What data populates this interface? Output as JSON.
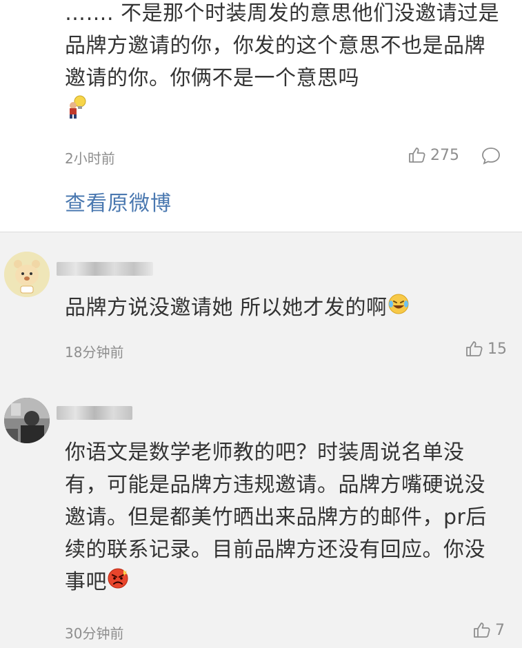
{
  "top_comment": {
    "text": "……. 不是那个时装周发的意思他们没邀请过是品牌方邀请的你，你发的这个意思不也是品牌邀请的你。你俩不是一个意思吗",
    "emoji": "lightbulb-person-emoji",
    "time": "2小时前",
    "likes": "275",
    "view_original_label": "查看原微博"
  },
  "replies": [
    {
      "avatar": "bear-avatar",
      "text": "品牌方说没邀请她 所以她才发的啊",
      "emoji": "laughing-tears-emoji",
      "time": "18分钟前",
      "likes": "15"
    },
    {
      "avatar": "photo-avatar",
      "text": "你语文是数学老师教的吧？时装周说名单没有，可能是品牌方违规邀请。品牌方嘴硬说没邀请。但是都美竹晒出来品牌方的邮件，pr后续的联系记录。目前品牌方还没有回应。你没事吧",
      "emoji": "angry-face-emoji",
      "time": "30分钟前",
      "likes": "7"
    }
  ],
  "colors": {
    "link": "#4a78b0",
    "meta": "#8e8e8e",
    "reply_bg": "#f2f2f2"
  }
}
